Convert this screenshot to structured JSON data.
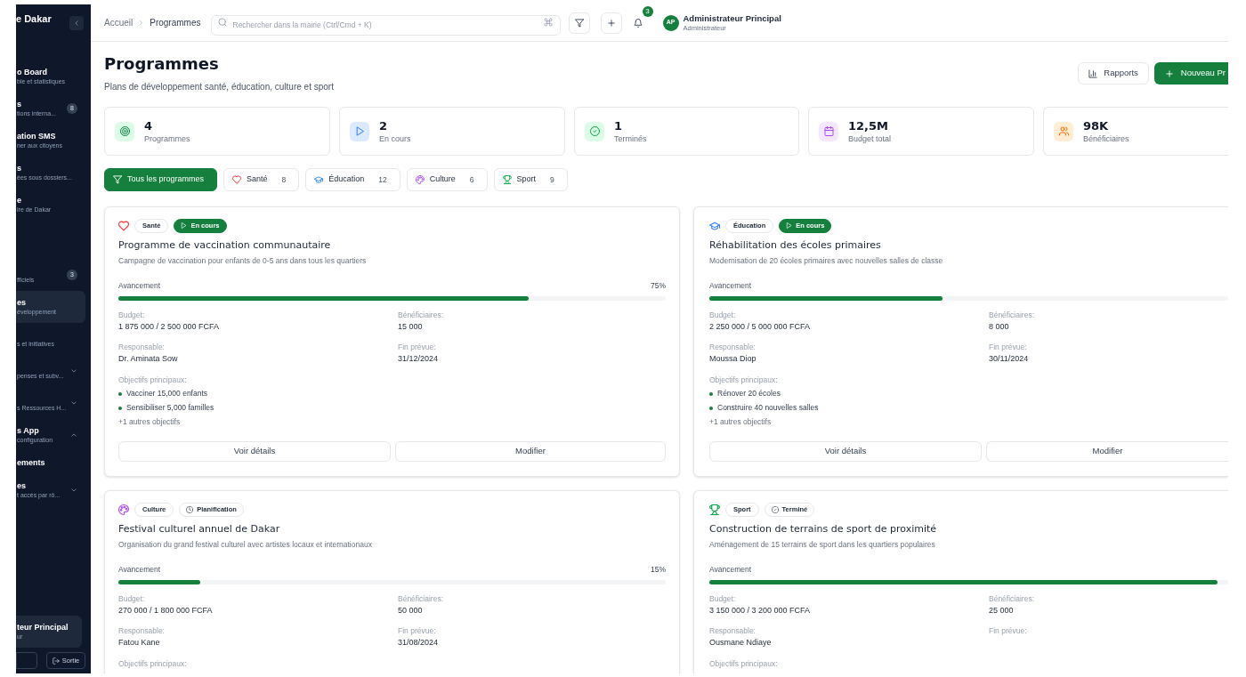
{
  "sidebar": {
    "brand": "e Dakar",
    "sections": [
      {
        "items": [
          {
            "kind": "link",
            "title": "o Board",
            "subtitle": "ble et statistiques",
            "selected": false
          },
          {
            "kind": "link",
            "title": "s",
            "subtitle": "tions interna...",
            "badge": "8",
            "selected": false
          },
          {
            "kind": "link",
            "title": "ation SMS",
            "subtitle": "ner aux citoyens",
            "selected": false
          },
          {
            "kind": "link",
            "title": "s",
            "subtitle": "ées sous dossiers...",
            "selected": false
          },
          {
            "kind": "link",
            "title": "e",
            "subtitle": "ire de Dakar",
            "selected": false
          }
        ]
      },
      {
        "items": [
          {
            "kind": "link",
            "subtitle": "fficiels",
            "badge": "3",
            "selected": false
          },
          {
            "kind": "link",
            "title": "es",
            "subtitle": "éveloppement",
            "selected": true
          },
          {
            "kind": "link",
            "subtitle": "s et initiatives",
            "selected": false
          },
          {
            "kind": "group",
            "subtitle": "penses et subv...",
            "expanded": false,
            "selected": false
          },
          {
            "kind": "group",
            "subtitle": "s Ressources H...",
            "expanded": false,
            "selected": false
          },
          {
            "kind": "group",
            "title": "s App",
            "subtitle": "configuration",
            "expanded": true,
            "selected": false,
            "children": [
              {
                "title": "ements",
                "selected": false
              }
            ]
          },
          {
            "kind": "group",
            "title": "es",
            "subtitle": "t accès par rô...",
            "expanded": false,
            "selected": false
          }
        ]
      }
    ],
    "user": {
      "name": "teur Principal",
      "role": "ur"
    },
    "logout_label": "Sortie"
  },
  "header": {
    "breadcrumb": [
      "Accueil",
      "Programmes"
    ],
    "search": {
      "placeholder": "Rechercher dans la mairie (Ctrl/Cmd + K)"
    },
    "notifications": "3",
    "user": {
      "initials": "AP",
      "name": "Administrateur Principal",
      "role": "Administrateur"
    }
  },
  "page": {
    "title": "Programmes",
    "subtitle": "Plans de développement santé, éducation, culture et sport",
    "actions": [
      {
        "kind": "secondary",
        "label": "Rapports"
      },
      {
        "kind": "primary",
        "label": "Nouveau Pr"
      }
    ]
  },
  "stats": [
    {
      "kind": "total",
      "value": "4",
      "label": "Programmes"
    },
    {
      "kind": "active",
      "value": "2",
      "label": "En cours"
    },
    {
      "kind": "done",
      "value": "1",
      "label": "Terminés"
    },
    {
      "kind": "budget",
      "value": "12,5M",
      "label": "Budget total"
    },
    {
      "kind": "people",
      "value": "98K",
      "label": "Bénéficiaires"
    }
  ],
  "filters": [
    {
      "kind": "all",
      "label": "Tous les programmes",
      "selected": true
    },
    {
      "kind": "health",
      "label": "Santé",
      "count": "8",
      "selected": false
    },
    {
      "kind": "education",
      "label": "Éducation",
      "count": "12",
      "selected": false
    },
    {
      "kind": "culture",
      "label": "Culture",
      "count": "6",
      "selected": false
    },
    {
      "kind": "sport",
      "label": "Sport",
      "count": "9",
      "selected": false
    }
  ],
  "programs": [
    {
      "kind": "health",
      "category": "Santé",
      "status": {
        "kind": "active",
        "label": "En cours"
      },
      "title": "Programme de vaccination communautaire",
      "description": "Campagne de vaccination pour enfants de 0-5 ans dans tous les quartiers",
      "progress": {
        "label": "Avancement",
        "text": "75%",
        "level": 0.75
      },
      "fields": [
        {
          "label": "Budget:",
          "value": "1 875 000 / 2 500 000 FCFA"
        },
        {
          "label": "Bénéficiaires:",
          "value": "15 000"
        },
        {
          "label": "Responsable:",
          "value": "Dr. Aminata Sow"
        },
        {
          "label": "Fin prévue:",
          "value": "31/12/2024"
        }
      ],
      "objectives": {
        "label": "Objectifs principaux:",
        "items": [
          "Vacciner 15,000 enfants",
          "Sensibiliser 5,000 familles"
        ],
        "more": "+1 autres objectifs"
      },
      "actions": [
        "Voir détails",
        "Modifier"
      ]
    },
    {
      "kind": "education",
      "category": "Éducation",
      "status": {
        "kind": "active",
        "label": "En cours"
      },
      "title": "Réhabilitation des écoles primaires",
      "description": "Modernisation de 20 écoles primaires avec nouvelles salles de classe",
      "progress": {
        "label": "Avancement",
        "level": 0.45
      },
      "fields": [
        {
          "label": "Budget:",
          "value": "2 250 000 / 5 000 000 FCFA"
        },
        {
          "label": "Bénéficiaires:",
          "value": "8 000"
        },
        {
          "label": "Responsable:",
          "value": "Moussa Diop"
        },
        {
          "label": "Fin prévue:",
          "value": "30/11/2024"
        }
      ],
      "objectives": {
        "label": "Objectifs principaux:",
        "items": [
          "Rénover 20 écoles",
          "Construire 40 nouvelles salles"
        ],
        "more": "+1 autres objectifs"
      },
      "actions": [
        "Voir détails",
        "Modifier"
      ]
    },
    {
      "kind": "culture",
      "category": "Culture",
      "status": {
        "kind": "planned",
        "label": "Planification"
      },
      "title": "Festival culturel annuel de Dakar",
      "description": "Organisation du grand festival culturel avec artistes locaux et internationaux",
      "progress": {
        "label": "Avancement",
        "text": "15%",
        "level": 0.15
      },
      "fields": [
        {
          "label": "Budget:",
          "value": "270 000 / 1 800 000 FCFA"
        },
        {
          "label": "Bénéficiaires:",
          "value": "50 000"
        },
        {
          "label": "Responsable:",
          "value": "Fatou Kane"
        },
        {
          "label": "Fin prévue:",
          "value": "31/08/2024"
        }
      ],
      "objectives": {
        "label": "Objectifs principaux:"
      }
    },
    {
      "kind": "sport",
      "category": "Sport",
      "status": {
        "kind": "done",
        "label": "Terminé"
      },
      "title": "Construction de terrains de sport de proximité",
      "description": "Aménagement de 15 terrains de sport dans les quartiers populaires",
      "progress": {
        "label": "Avancement",
        "level": 0.98
      },
      "fields": [
        {
          "label": "Budget:",
          "value": "3 150 000 / 3 200 000 FCFA"
        },
        {
          "label": "Bénéficiaires:",
          "value": "25 000"
        },
        {
          "label": "Responsable:",
          "value": "Ousmane Ndiaye"
        },
        {
          "label": "Fin prévue:"
        }
      ],
      "objectives": {
        "label": "Objectifs principaux:"
      }
    }
  ]
}
